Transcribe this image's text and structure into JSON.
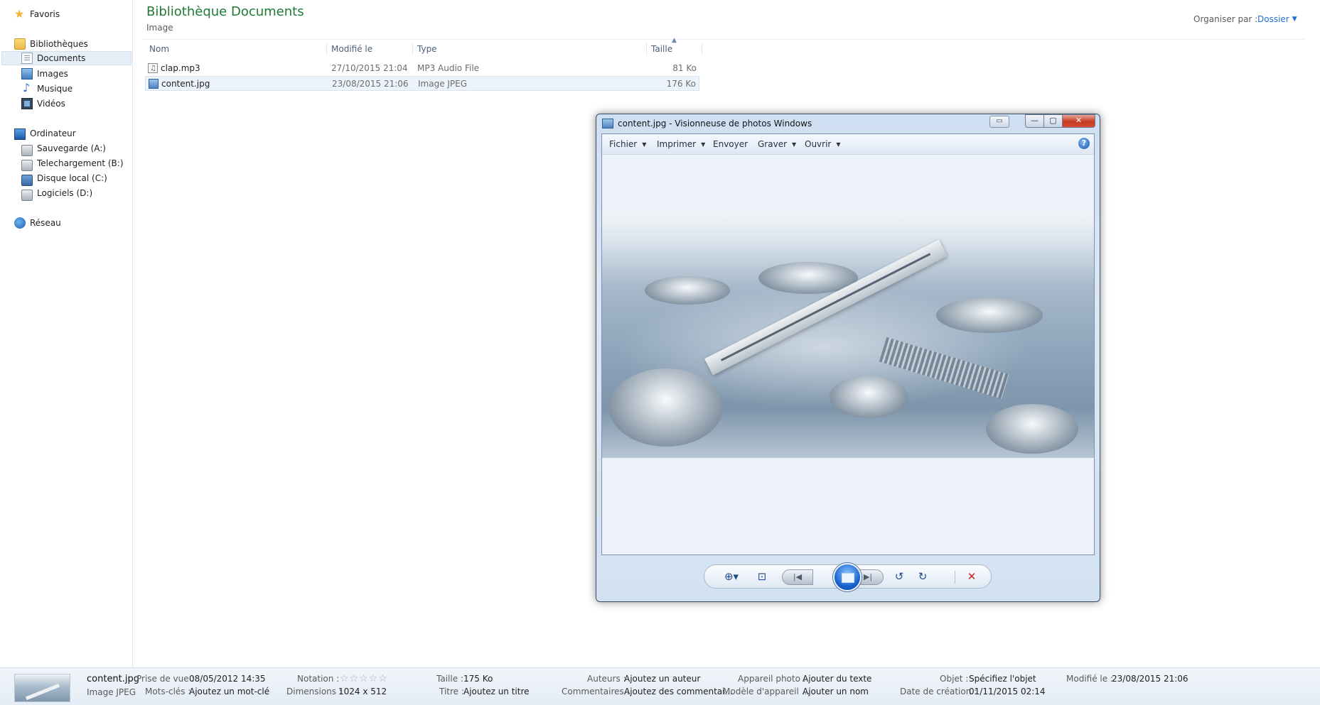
{
  "sidebar": {
    "favorites": "Favoris",
    "libraries": "Bibliothèques",
    "documents": "Documents",
    "images": "Images",
    "music": "Musique",
    "videos": "Vidéos",
    "computer": "Ordinateur",
    "drive_a": "Sauvegarde (A:)",
    "drive_b": "Telechargement (B:)",
    "drive_c": "Disque local (C:)",
    "drive_d": "Logiciels (D:)",
    "network": "Réseau"
  },
  "header": {
    "title": "Bibliothèque Documents",
    "subtitle": "Image",
    "organize_label": "Organiser par :",
    "organize_value": "Dossier"
  },
  "columns": {
    "name": "Nom",
    "modified": "Modifié le",
    "type": "Type",
    "size": "Taille"
  },
  "files": [
    {
      "name": "clap.mp3",
      "modified": "27/10/2015 21:04",
      "type": "MP3 Audio File",
      "size": "81 Ko",
      "selected": false
    },
    {
      "name": "content.jpg",
      "modified": "23/08/2015 21:06",
      "type": "Image JPEG",
      "size": "176 Ko",
      "selected": true
    }
  ],
  "viewer": {
    "title": "content.jpg - Visionneuse de photos Windows",
    "menu": {
      "file": "Fichier",
      "print": "Imprimer",
      "send": "Envoyer",
      "burn": "Graver",
      "open": "Ouvrir"
    },
    "help": "?",
    "toolbar_icons": [
      "zoom-icon",
      "actual-size-icon",
      "previous-icon",
      "slideshow-icon",
      "next-icon",
      "rotate-left-icon",
      "rotate-right-icon",
      "delete-icon"
    ]
  },
  "details": {
    "name": "content.jpg",
    "type": "Image JPEG",
    "date_taken_label": "Prise de vue :",
    "date_taken": "08/05/2012 14:35",
    "keywords_label": "Mots-clés :",
    "keywords": "Ajoutez un mot-clé",
    "rating_label": "Notation :",
    "rating": 0,
    "dimensions_label": "Dimensions :",
    "dimensions": "1024 x 512",
    "size_label": "Taille :",
    "size": "175 Ko",
    "title_label": "Titre :",
    "title": "Ajoutez un titre",
    "authors_label": "Auteurs :",
    "authors": "Ajoutez un auteur",
    "comments_label": "Commentaires :",
    "comments": "Ajoutez des commentai...",
    "camera_label": "Appareil photo :",
    "camera": "Ajouter du texte",
    "model_label": "Modèle d'appareil ...",
    "model": "Ajouter un nom",
    "subject_label": "Objet :",
    "subject": "Spécifiez l'objet",
    "created_label": "Date de création :",
    "created": "01/11/2015 02:14",
    "modified_label": "Modifié le :",
    "modified": "23/08/2015 21:06"
  },
  "colors": {
    "title_green": "#1e7a34",
    "link_blue": "#1f6fd1",
    "close_red": "#c63a24"
  }
}
